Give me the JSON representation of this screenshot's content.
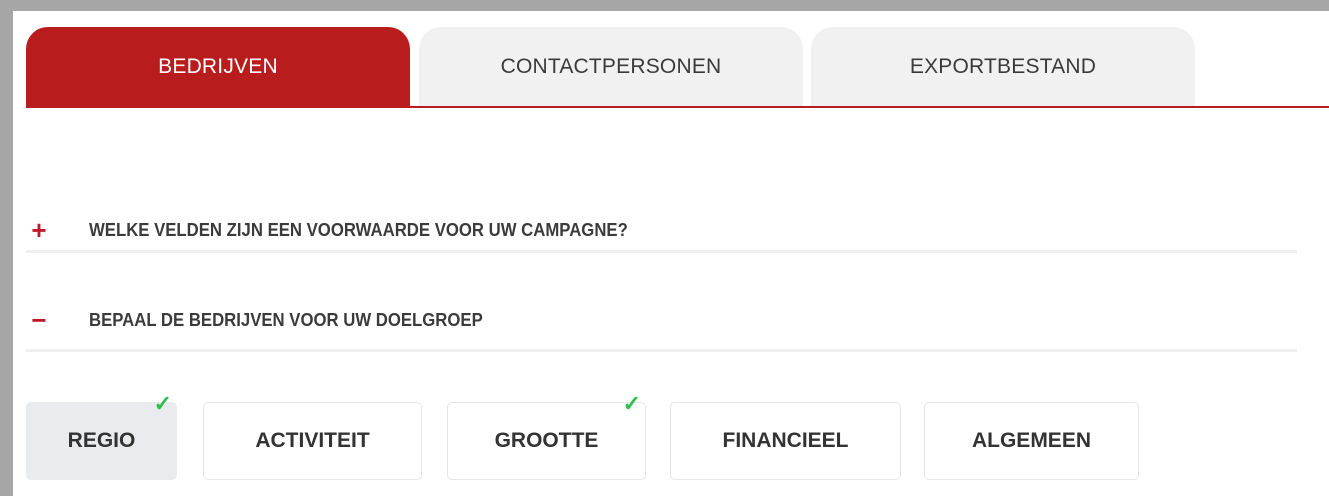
{
  "tabs": [
    {
      "label": "BEDRIJVEN",
      "active": true
    },
    {
      "label": "CONTACTPERSONEN",
      "active": false
    },
    {
      "label": "EXPORTBESTAND",
      "active": false
    }
  ],
  "sections": [
    {
      "sign": "+",
      "title": "WELKE VELDEN ZIJN EEN VOORWAARDE VOOR UW CAMPAGNE?",
      "expanded": false
    },
    {
      "sign": "−",
      "title": "BEPAAL DE BEDRIJVEN VOOR UW DOELGROEP",
      "expanded": true
    }
  ],
  "filters": [
    {
      "label": "REGIO",
      "selected": true,
      "checked": true
    },
    {
      "label": "ACTIVITEIT",
      "selected": false,
      "checked": false
    },
    {
      "label": "GROOTTE",
      "selected": false,
      "checked": true
    },
    {
      "label": "FINANCIEEL",
      "selected": false,
      "checked": false
    },
    {
      "label": "ALGEMEEN",
      "selected": false,
      "checked": false
    }
  ],
  "icons": {
    "check": "✓"
  },
  "colors": {
    "accent": "#b91c1c",
    "check": "#2fbf4a",
    "inactive_tab": "#f1f1f1",
    "selected_filter": "#e9ebee",
    "frame": "#a6a6a6"
  }
}
